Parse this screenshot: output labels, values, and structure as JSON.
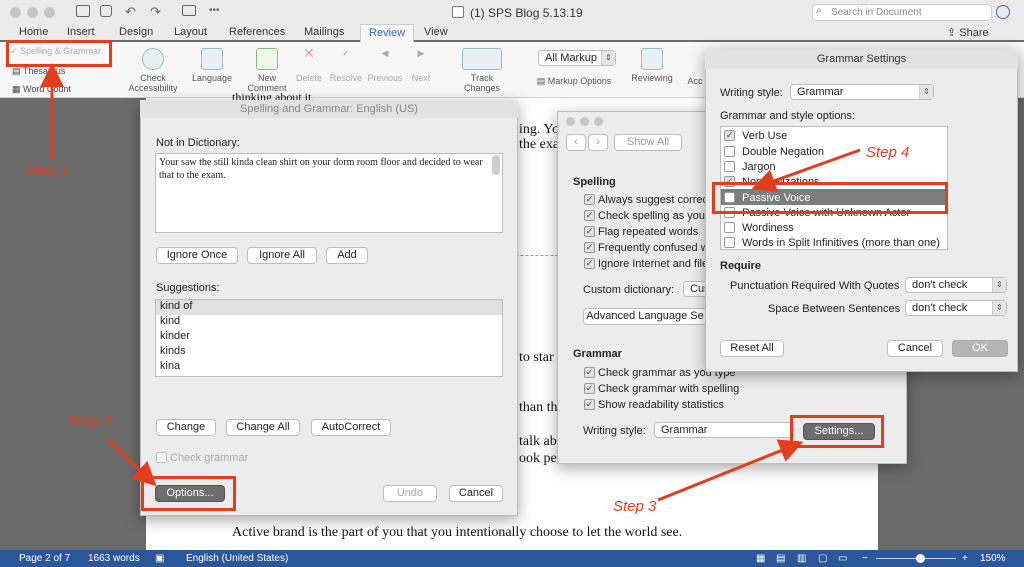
{
  "window": {
    "title": "(1) SPS Blog 5.13.19",
    "search_placeholder": "Search in Document",
    "share_label": "Share"
  },
  "tabs": [
    "Home",
    "Insert",
    "Design",
    "Layout",
    "References",
    "Mailings",
    "Review",
    "View"
  ],
  "ribbon": {
    "proofing": [
      "Spelling & Grammar",
      "Thesaurus",
      "Word Count"
    ],
    "check_accessibility": "Check Accessibility",
    "language": "Language",
    "new_comment": "New Comment",
    "delete": "Delete",
    "resolve": "Resolve",
    "previous": "Previous",
    "next": "Next",
    "track_changes": "Track Changes",
    "markup_select": "All Markup",
    "markup_options": "Markup Options",
    "reviewing": "Reviewing",
    "accept_partial": "Acc"
  },
  "document": {
    "line_top": "thinking about it.",
    "frag1": "ing. You",
    "frag2": "the exa",
    "frag3": "to star",
    "frag4": "than th",
    "frag5": "talk ab",
    "frag6": "ook pe",
    "bottom": "Active brand is the part of you that you intentionally choose to let the world see."
  },
  "status": {
    "page": "Page 2 of 7",
    "words": "1663 words",
    "language": "English (United States)",
    "zoom": "150%",
    "zoom_level": 0.55
  },
  "spelling_dialog": {
    "title": "Spelling and Grammar: English (US)",
    "not_in_dict_label": "Not in Dictionary:",
    "text": "Your saw the still kinda clean shirt on your dorm room floor and decided to wear that to the exam.",
    "ignore_once": "Ignore Once",
    "ignore_all": "Ignore All",
    "add": "Add",
    "suggestions_label": "Suggestions:",
    "suggestions": [
      "kind of",
      "kind",
      "kinder",
      "kinds",
      "kina"
    ],
    "change": "Change",
    "change_all": "Change All",
    "autocorrect": "AutoCorrect",
    "check_grammar": "Check grammar",
    "options": "Options...",
    "undo": "Undo",
    "cancel": "Cancel"
  },
  "prefs_dialog": {
    "show_all": "Show All",
    "spelling_header": "Spelling",
    "spelling_options": [
      "Always suggest correc",
      "Check spelling as you",
      "Flag repeated words",
      "Frequently confused w",
      "Ignore Internet and file"
    ],
    "custom_dict_label": "Custom dictionary:",
    "custom_dict_value": "Cus",
    "advanced": "Advanced Language Se",
    "grammar_header": "Grammar",
    "grammar_options": [
      "Check grammar as you type",
      "Check grammar with spelling",
      "Show readability statistics"
    ],
    "writing_style_label": "Writing style:",
    "writing_style_value": "Grammar",
    "settings": "Settings..."
  },
  "grammar_settings": {
    "title": "Grammar Settings",
    "writing_style_label": "Writing style:",
    "writing_style_value": "Grammar",
    "options_label": "Grammar and style options:",
    "options": [
      "Verb Use",
      "Double Negation",
      "Jargon",
      "Nominalizations",
      "Passive Voice",
      "Passive Voice with Unknown Actor",
      "Wordiness",
      "Words in Split Infinitives (more than one)"
    ],
    "require_label": "Require",
    "punct_label": "Punctuation Required With Quotes",
    "punct_value": "don't check",
    "space_label": "Space Between Sentences",
    "space_value": "don't check",
    "reset_all": "Reset All",
    "cancel": "Cancel",
    "ok": "OK"
  },
  "steps": {
    "step1": "Step 1",
    "step2": "Step 2",
    "step3": "Step 3",
    "step4": "Step 4"
  },
  "colors": {
    "annotation": "#e63c1e",
    "statusbar": "#2b579a",
    "review_tab": "#3864b4"
  }
}
